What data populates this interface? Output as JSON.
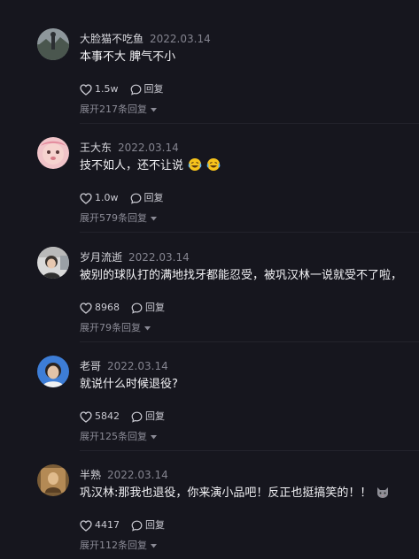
{
  "comments": [
    {
      "username": "大脸猫不吃鱼",
      "date": "2022.03.14",
      "text": "本事不大 脾气不小",
      "likes": "1.5w",
      "reply_label": "回复",
      "expand_label": "展开217条回复",
      "avatar_icon": "avatar-photo-landscape",
      "avatar_color": "#6f7a82"
    },
    {
      "username": "王大东",
      "date": "2022.03.14",
      "text": "技不如人，还不让说",
      "emojis": [
        "laughing-crying-emoji",
        "laughing-crying-emoji"
      ],
      "likes": "1.0w",
      "reply_label": "回复",
      "expand_label": "展开579条回复",
      "avatar_icon": "avatar-pink-baby",
      "avatar_color": "#e7a6b0"
    },
    {
      "username": "岁月流逝",
      "date": "2022.03.14",
      "text": "被别的球队打的满地找牙都能忍受，被巩汉林一说就受不了啦，",
      "likes": "8968",
      "reply_label": "回复",
      "expand_label": "展开79条回复",
      "avatar_icon": "avatar-person-in-car",
      "avatar_color": "#c7c7c7"
    },
    {
      "username": "老哥",
      "date": "2022.03.14",
      "text": "就说什么时候退役?",
      "likes": "5842",
      "reply_label": "回复",
      "expand_label": "展开125条回复",
      "avatar_icon": "avatar-person-blue-bg",
      "avatar_color": "#3d7dd6"
    },
    {
      "username": "半熟",
      "date": "2022.03.14",
      "text": "巩汉林:那我也退役，你来演小品吧！反正也挺搞笑的！！",
      "emojis": [
        "cat-face-emoji"
      ],
      "likes": "4417",
      "reply_label": "回复",
      "expand_label": "展开112条回复",
      "avatar_icon": "avatar-photo-warm",
      "avatar_color": "#9a7a4e"
    }
  ]
}
